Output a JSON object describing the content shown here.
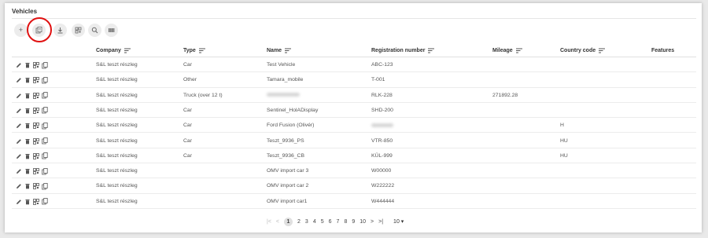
{
  "page": {
    "title": "Vehicles"
  },
  "toolbar": {
    "buttons": [
      {
        "name": "add-button",
        "glyph": "+"
      },
      {
        "name": "copy-list-button",
        "glyph": ""
      },
      {
        "name": "download-button",
        "glyph": ""
      },
      {
        "name": "qr-button",
        "glyph": ""
      },
      {
        "name": "search-button",
        "glyph": ""
      },
      {
        "name": "columns-button",
        "glyph": ""
      }
    ]
  },
  "columns": [
    {
      "key": "company",
      "label": "Company",
      "sortable": true
    },
    {
      "key": "type",
      "label": "Type",
      "sortable": true
    },
    {
      "key": "name",
      "label": "Name",
      "sortable": true
    },
    {
      "key": "reg",
      "label": "Registration number",
      "sortable": true
    },
    {
      "key": "mileage",
      "label": "Mileage",
      "sortable": true
    },
    {
      "key": "country",
      "label": "Country code",
      "sortable": true
    },
    {
      "key": "features",
      "label": "Features",
      "sortable": false
    }
  ],
  "rows": [
    {
      "company": "S&L teszt részleg",
      "type": "Car",
      "name": "Test Vehicle",
      "reg": "ABC-123",
      "mileage": "",
      "country": "",
      "features": ""
    },
    {
      "company": "S&L teszt részleg",
      "type": "Other",
      "name": "Tamara_mobile",
      "reg": "T-001",
      "mileage": "",
      "country": "",
      "features": ""
    },
    {
      "company": "S&L teszt részleg",
      "type": "Truck (over 12 t)",
      "name": "",
      "name_blurred": true,
      "reg": "RLK-228",
      "mileage": "271892.28",
      "country": "",
      "features": ""
    },
    {
      "company": "S&L teszt részleg",
      "type": "Car",
      "name": "Sentinel_HolADisplay",
      "reg": "SHD-200",
      "mileage": "",
      "country": "",
      "features": ""
    },
    {
      "company": "S&L teszt részleg",
      "type": "Car",
      "name": "Ford Fusion (Olivér)",
      "reg": "",
      "reg_blurred": true,
      "mileage": "",
      "country": "H",
      "features": ""
    },
    {
      "company": "S&L teszt részleg",
      "type": "Car",
      "name": "Teszt_9936_PS",
      "reg": "VTR-850",
      "mileage": "",
      "country": "HU",
      "features": ""
    },
    {
      "company": "S&L teszt részleg",
      "type": "Car",
      "name": "Teszt_9936_CB",
      "reg": "KÜL-999",
      "mileage": "",
      "country": "HU",
      "features": ""
    },
    {
      "company": "S&L teszt részleg",
      "type": "",
      "name": "OMV import car 3",
      "reg": "W00000",
      "mileage": "",
      "country": "",
      "features": ""
    },
    {
      "company": "S&L teszt részleg",
      "type": "",
      "name": "OMV import car 2",
      "reg": "W222222",
      "mileage": "",
      "country": "",
      "features": ""
    },
    {
      "company": "S&L teszt részleg",
      "type": "",
      "name": "OMV import car1",
      "reg": "W444444",
      "mileage": "",
      "country": "",
      "features": ""
    }
  ],
  "pagination": {
    "pages": [
      "1",
      "2",
      "3",
      "4",
      "5",
      "6",
      "7",
      "8",
      "9",
      "10"
    ],
    "current": "1",
    "first": "|<",
    "prev": "<",
    "next": ">",
    "last": ">|",
    "per_page": "10 ▾"
  },
  "colors": {
    "highlight": "#e01010",
    "icon": "#666666"
  }
}
